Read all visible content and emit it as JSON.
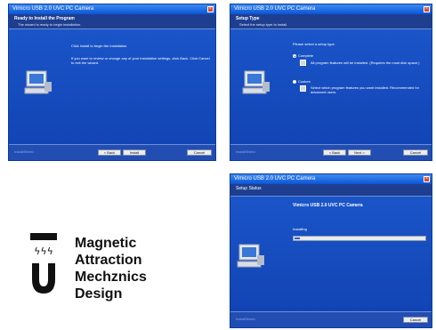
{
  "app_title": "Vimicro USB 2.0 UVC PC Camera",
  "window_ready": {
    "header_title": "Ready to Install the Program",
    "header_subtitle": "The wizard is ready to begin installation.",
    "line1": "Click Install to begin the installation.",
    "line2": "If you want to review or change any of your installation settings, click Back. Click Cancel to exit the wizard.",
    "buttons": {
      "back": "< Back",
      "install": "Install",
      "cancel": "Cancel"
    }
  },
  "window_setup": {
    "header_title": "Setup Type",
    "header_subtitle": "Select the setup type to install.",
    "prompt": "Please select a setup type.",
    "option_complete": {
      "label": "Complete",
      "desc": "All program features will be installed. (Requires the most disk space.)"
    },
    "option_custom": {
      "label": "Custom",
      "desc": "Select which program features you want installed. Recommended for advanced users."
    },
    "buttons": {
      "back": "< Back",
      "next": "Next >",
      "cancel": "Cancel"
    }
  },
  "window_status": {
    "header_title": "Setup Status",
    "product": "Vimicro USB 2.0 UVC PC Camera",
    "status": "Installing",
    "progress": 0.04,
    "buttons": {
      "cancel": "Cancel"
    }
  },
  "footer_brand": "InstallShield",
  "logo": {
    "line1": "Magnetic",
    "line2": "Attraction",
    "line3": "Mechznics",
    "line4": "Design"
  }
}
